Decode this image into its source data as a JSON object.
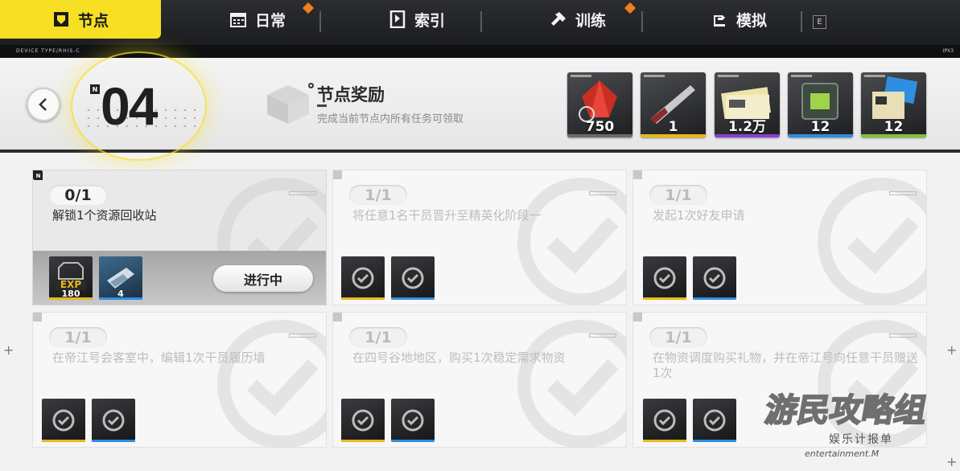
{
  "nav": {
    "tabs": [
      {
        "label": "节点",
        "icon": "node-icon"
      },
      {
        "label": "日常",
        "icon": "calendar-icon"
      },
      {
        "label": "索引",
        "icon": "index-icon"
      },
      {
        "label": "训练",
        "icon": "hammer-icon"
      },
      {
        "label": "模拟",
        "icon": "simulate-icon"
      }
    ],
    "key_hint": "E"
  },
  "strip": {
    "brand_left": "DEVICE TYPE/RHIS-C",
    "brand_right": "IPX3"
  },
  "header": {
    "node_number": "04",
    "reward_title": "节点奖励",
    "reward_subtitle": "完成当前节点内所有任务可领取",
    "rewards": [
      {
        "item": "red-crystal-icon",
        "qty": "750",
        "rarity_color": "#6b6b6b"
      },
      {
        "item": "blade-icon",
        "qty": "1",
        "rarity_color": "#e8b818"
      },
      {
        "item": "voucher-icon",
        "qty": "1.2万",
        "rarity_color": "#8a3fd0"
      },
      {
        "item": "module-icon",
        "qty": "12",
        "rarity_color": "#2e8fe0"
      },
      {
        "item": "exp-card-icon",
        "qty": "12",
        "rarity_color": "#7fc23a"
      }
    ]
  },
  "tasks": [
    {
      "progress": "0/1",
      "desc": "解锁1个资源回收站",
      "active": true,
      "button": "进行中",
      "rewards": [
        {
          "item": "exp-icon",
          "label": "EXP",
          "qty": "180",
          "strip": "#e8b818"
        },
        {
          "item": "module-icon",
          "qty": "4",
          "strip": "#2e8fe0"
        }
      ]
    },
    {
      "progress": "1/1",
      "desc": "将任意1名干员晋升至精英化阶段一",
      "active": false,
      "rewards": [
        {
          "strip": "#e8b818"
        },
        {
          "strip": "#2e8fe0"
        }
      ]
    },
    {
      "progress": "1/1",
      "desc": "发起1次好友申请",
      "active": false,
      "rewards": [
        {
          "strip": "#e8b818"
        },
        {
          "strip": "#2e8fe0"
        }
      ]
    },
    {
      "progress": "1/1",
      "desc": "在帝江号会客室中，编辑1次干员履历墙",
      "active": false,
      "rewards": [
        {
          "strip": "#e8b818"
        },
        {
          "strip": "#2e8fe0"
        }
      ]
    },
    {
      "progress": "1/1",
      "desc": "在四号谷地地区，购买1次稳定需求物资",
      "active": false,
      "rewards": [
        {
          "strip": "#e8b818"
        },
        {
          "strip": "#2e8fe0"
        }
      ]
    },
    {
      "progress": "1/1",
      "desc": "在物资调度购买礼物，并在帝江号向任意干员赠送1次",
      "active": false,
      "rewards": [
        {
          "strip": "#e8b818"
        },
        {
          "strip": "#2e8fe0"
        }
      ]
    }
  ],
  "watermark": {
    "logo": "游民攻略组",
    "cn": "娱乐计报单",
    "en": "entertainment.M"
  }
}
